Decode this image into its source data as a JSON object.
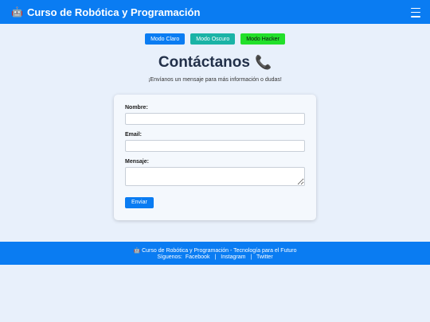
{
  "navbar": {
    "brand_icon": "robot-icon",
    "brand_glyph": "🤖",
    "brand_title": "Curso de Robótica y Programación",
    "menu_icon": "hamburger-menu-icon"
  },
  "themes": [
    {
      "label": "Modo Claro",
      "color": "#0a7cf2"
    },
    {
      "label": "Modo Oscuro",
      "color": "#1ab3a6"
    },
    {
      "label": "Modo Hacker",
      "color": "#22e02a"
    }
  ],
  "contact": {
    "title": "Contáctanos",
    "title_icon": "phone-icon",
    "title_glyph": "📞",
    "subtitle": "¡Envíanos un mensaje para más información o dudas!"
  },
  "form": {
    "name_label": "Nombre:",
    "email_label": "Email:",
    "message_label": "Mensaje:",
    "submit_label": "Enviar"
  },
  "footer": {
    "credit": "🤖 Curso de Robótica y Programación - Tecnología para el Futuro",
    "follow_label": "Síguenos:",
    "links": [
      "Facebook",
      "Instagram",
      "Twitter"
    ],
    "separator": "|"
  },
  "colors": {
    "accent": "#0a7cf2",
    "background": "#e8f0fb",
    "card": "#f4f8fd"
  }
}
